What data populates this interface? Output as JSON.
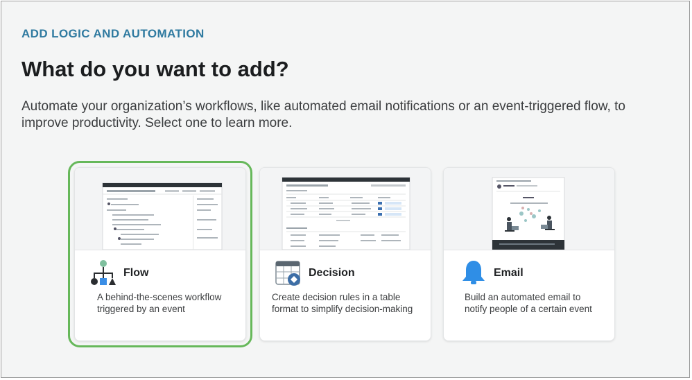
{
  "header": {
    "eyebrow": "ADD LOGIC AND AUTOMATION",
    "title": "What do you want to add?",
    "description": "Automate your organization’s workflows, like automated email notifications or an event-triggered flow, to improve productivity. Select one to learn more."
  },
  "cards": [
    {
      "title": "Flow",
      "description": "A behind-the-scenes workflow triggered by an event",
      "icon": "flow-icon",
      "selected": true
    },
    {
      "title": "Decision",
      "description": "Create decision rules in a table format to simplify decision-making",
      "icon": "decision-table-icon",
      "selected": false
    },
    {
      "title": "Email",
      "description": "Build an automated email to notify people of a certain event",
      "icon": "bell-icon",
      "selected": false
    }
  ],
  "colors": {
    "eyebrow": "#2f7aa0",
    "selected_outline": "#66b85a",
    "flow_icon_green": "#7fbf9e",
    "flow_icon_blue": "#3a8ee6",
    "decision_icon_blue": "#3d6ea6",
    "email_icon_blue": "#2f8ee6"
  }
}
